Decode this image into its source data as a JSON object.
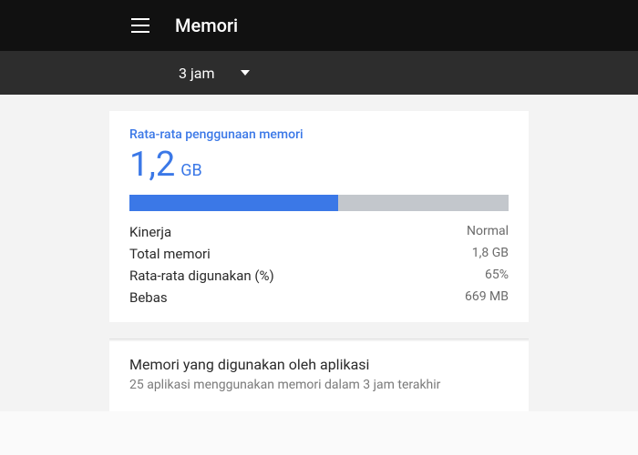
{
  "header": {
    "title": "Memori"
  },
  "dropdown": {
    "selected": "3 jam"
  },
  "memory": {
    "avg_label": "Rata-rata penggunaan memori",
    "avg_value": "1,2",
    "avg_unit": "GB",
    "bar_percent": 55,
    "stats": [
      {
        "label": "Kinerja",
        "value": "Normal"
      },
      {
        "label": "Total memori",
        "value": "1,8 GB"
      },
      {
        "label": "Rata-rata digunakan (%)",
        "value": "65%"
      },
      {
        "label": "Bebas",
        "value": "669 MB"
      }
    ]
  },
  "apps": {
    "title": "Memori yang digunakan oleh aplikasi",
    "subtitle": "25 aplikasi menggunakan memori dalam 3 jam terakhir"
  },
  "colors": {
    "accent": "#3b78e7"
  }
}
